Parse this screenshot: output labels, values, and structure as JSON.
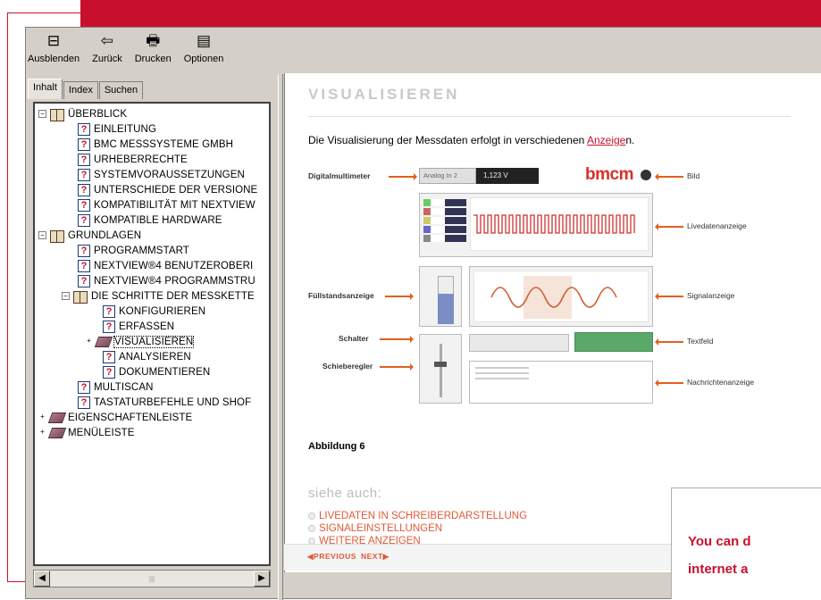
{
  "toolbar": {
    "hide_label": "Ausblenden",
    "back_label": "Zurück",
    "print_label": "Drucken",
    "options_label": "Optionen"
  },
  "tabs": {
    "contents": "Inhalt",
    "index": "Index",
    "search": "Suchen"
  },
  "tree": {
    "overview": "ÜBERBLICK",
    "intro": "EINLEITUNG",
    "bmc": "BMC MESSSYSTEME GMBH",
    "copyright": "URHEBERRECHTE",
    "sysreq": "SYSTEMVORAUSSETZUNGEN",
    "diffs": "UNTERSCHIEDE DER VERSIONE",
    "compat_nv": "KOMPATIBILITÄT MIT NEXTVIEW",
    "compat_hw": "KOMPATIBLE HARDWARE",
    "basics": "GRUNDLAGEN",
    "progstart": "PROGRAMMSTART",
    "nv_ui": "NEXTVIEW®4 BENUTZEROBERI",
    "nv_struct": "NEXTVIEW®4 PROGRAMMSTRU",
    "steps": "DIE SCHRITTE DER MESSKETTE",
    "configure": "KONFIGURIEREN",
    "capture": "ERFASSEN",
    "visualize": "VISUALISIEREN",
    "analyze": "ANALYSIEREN",
    "document": "DOKUMENTIEREN",
    "multiscan": "MULTISCAN",
    "shortcuts": "TASTATURBEFEHLE UND SHOF",
    "propbar": "EIGENSCHAFTENLEISTE",
    "menubar": "MENÜLEISTE"
  },
  "content": {
    "title": "VISUALISIEREN",
    "intro_text": "Die Visualisierung der Messdaten erfolgt in verschiedenen ",
    "intro_link": "Anzeige",
    "intro_tail": "n.",
    "figure_caption": "Abbildung 6",
    "see_also": "siehe auch:",
    "links": [
      "LIVEDATEN IN SCHREIBERDARSTELLUNG",
      "SIGNALEINSTELLUNGEN",
      "WEITERE ANZEIGEN"
    ]
  },
  "figure": {
    "left_labels": [
      "Digitalmultimeter",
      "Füllstandsanzeige",
      "Schalter",
      "Schieberegler"
    ],
    "right_labels": [
      "Bild",
      "Livedatenanzeige",
      "Signalanzeige",
      "Textfeld",
      "Nachrichtenanzeige"
    ],
    "dm_channel": "Analog In 2",
    "dm_value": "1,123 V",
    "logo": "bmcm"
  },
  "nav": {
    "previous": "PREVIOUS",
    "next": "NEXT"
  },
  "callout": {
    "line1": "You can d",
    "line2": "internet a"
  },
  "colors": {
    "brand_red": "#c8102e",
    "accent_orange": "#e05a3a"
  }
}
